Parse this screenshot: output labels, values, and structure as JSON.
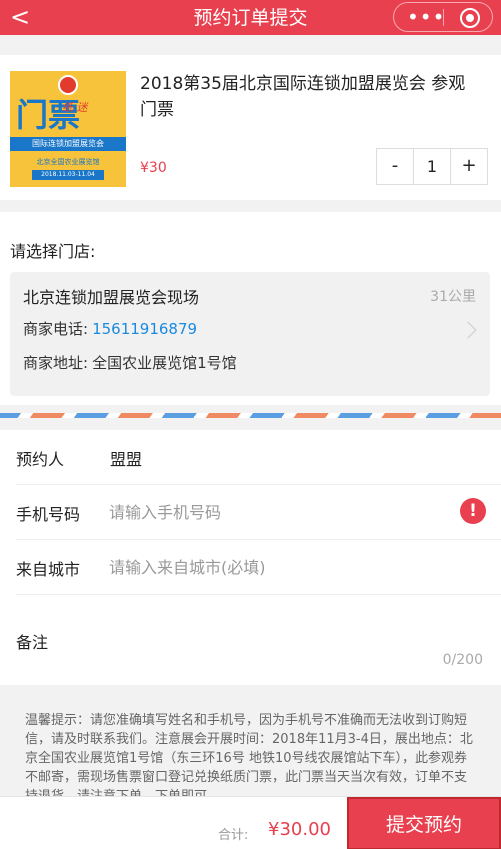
{
  "nav": {
    "back_glyph": "<",
    "title": "预约订单提交",
    "more_glyph": "•••",
    "colors": {
      "accent": "#e9404f"
    }
  },
  "product": {
    "name": "2018第35届北京国际连锁加盟展览会 参观门票",
    "price": "¥30",
    "quantity": "1",
    "minus_label": "-",
    "plus_label": "+",
    "thumb": {
      "big_text": "门票",
      "hand_text": "纸 迷",
      "band_text": "国际连锁加盟展览会",
      "sub_text": "北京全国农业展览馆",
      "date_text": "2018.11.03-11.04"
    }
  },
  "store": {
    "section_label": "请选择门店:",
    "name": "北京连锁加盟展览会现场",
    "distance": "31公里",
    "phone_label": "商家电话:",
    "phone_value": "15611916879",
    "address_label": "商家地址:",
    "address_value": "全国农业展览馆1号馆"
  },
  "form": {
    "booker_label": "预约人",
    "booker_value": "盟盟",
    "phone_label": "手机号码",
    "phone_placeholder": "请输入手机号码",
    "warning_glyph": "!",
    "city_label": "来自城市",
    "city_placeholder": "请输入来自城市(必填)",
    "notes_label": "备注",
    "notes_count": "0/200"
  },
  "tips": "温馨提示：请您准确填写姓名和手机号，因为手机号不准确而无法收到订购短信，请及时联系我们。注意展会开展时间：2018年11月3-4日，展出地点：北京全国农业展览馆1号馆（东三环16号 地铁10号线农展馆站下车），此参观券不邮寄，需现场售票窗口登记兑换纸质门票，此门票当天当次有效，订单不支持退货，请注意下单，下单即可",
  "footer": {
    "total_label": "合计:",
    "total_value": "¥30.00",
    "submit_label": "提交预约"
  }
}
